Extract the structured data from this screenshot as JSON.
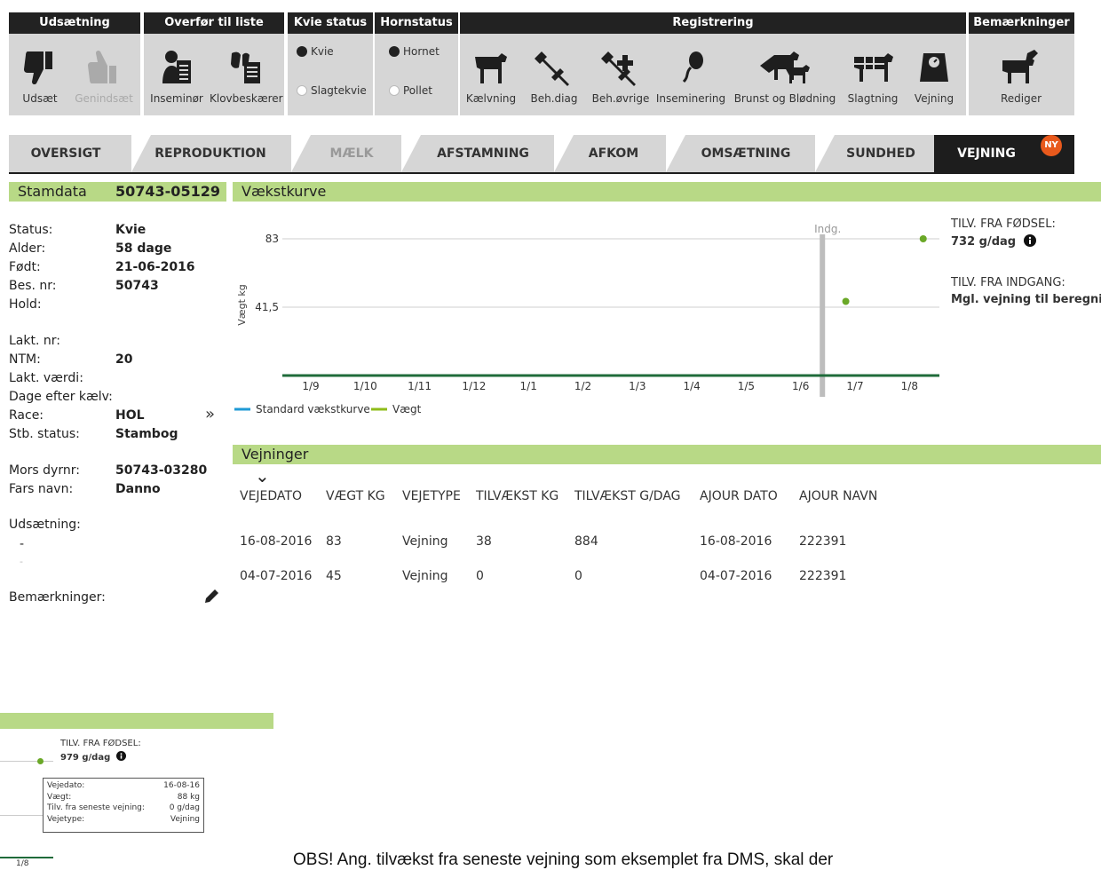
{
  "toolbar": {
    "udsaetning": {
      "header": "Udsætning",
      "udsaet": "Udsæt",
      "genindsaet": "Genindsæt"
    },
    "overfoer": {
      "header": "Overfør til liste",
      "inseminoer": "Inseminør",
      "klovbeskaerer": "Klovbeskærer"
    },
    "kvie_status": {
      "header": "Kvie status",
      "options": [
        "Kvie",
        "Slagtekvie"
      ],
      "selected": "Kvie"
    },
    "hornstatus": {
      "header": "Hornstatus",
      "options": [
        "Hornet",
        "Pollet"
      ],
      "selected": "Hornet"
    },
    "registrering": {
      "header": "Registrering",
      "items": [
        "Kælvning",
        "Beh.diag",
        "Beh.øvrige",
        "Inseminering",
        "Brunst og Blødning",
        "Slagtning",
        "Vejning"
      ]
    },
    "bemaerkninger": {
      "header": "Bemærkninger",
      "rediger": "Rediger"
    }
  },
  "tabs": [
    {
      "label": "OVERSIGT"
    },
    {
      "label": "REPRODUKTION"
    },
    {
      "label": "MÆLK"
    },
    {
      "label": "AFSTAMNING"
    },
    {
      "label": "AFKOM"
    },
    {
      "label": "OMSÆTNING"
    },
    {
      "label": "SUNDHED"
    },
    {
      "label": "VEJNING",
      "badge": "NY"
    }
  ],
  "stamdata": {
    "title": "Stamdata",
    "id": "50743-05129",
    "fields": {
      "status": {
        "label": "Status:",
        "value": "Kvie"
      },
      "alder": {
        "label": "Alder:",
        "value": "58 dage"
      },
      "foedt": {
        "label": "Født:",
        "value": "21-06-2016"
      },
      "bes_nr": {
        "label": "Bes. nr:",
        "value": "50743"
      },
      "hold": {
        "label": "Hold:",
        "value": ""
      },
      "lakt_nr": {
        "label": "Lakt. nr:",
        "value": ""
      },
      "ntm": {
        "label": "NTM:",
        "value": "20"
      },
      "lakt_vaerdi": {
        "label": "Lakt. værdi:",
        "value": ""
      },
      "dage_efter_kaelv": {
        "label": "Dage efter kælv:",
        "value": ""
      },
      "race": {
        "label": "Race:",
        "value": "HOL"
      },
      "stb_status": {
        "label": "Stb. status:",
        "value": "Stambog"
      },
      "mors_dyrnr": {
        "label": "Mors dyrnr:",
        "value": "50743-03280"
      },
      "fars_navn": {
        "label": "Fars navn:",
        "value": "Danno"
      }
    },
    "udsaetning_label": "Udsætning:",
    "udsaetning_value": "-",
    "udsaetning_value2": "-",
    "bemaerkninger_label": "Bemærkninger:",
    "expand_glyph": "»"
  },
  "vaekstkurve": {
    "title": "Vækstkurve",
    "tilv_foedsel_label": "TILV. FRA FØDSEL:",
    "tilv_foedsel_value": "732 g/dag",
    "tilv_indgang_label": "TILV. FRA INDGANG:",
    "tilv_indgang_value": "Mgl. vejning til beregnir"
  },
  "chart_data": {
    "type": "line",
    "ylabel": "Vægt kg",
    "yticks": [
      83,
      41.5
    ],
    "ytick_labels": [
      "83",
      "41,5"
    ],
    "ylim": [
      0,
      90
    ],
    "x_tick_labels": [
      "1/9",
      "1/10",
      "1/11",
      "1/12",
      "1/1",
      "1/2",
      "1/3",
      "1/4",
      "1/5",
      "1/6",
      "1/7",
      "1/8"
    ],
    "marker": {
      "label": "Indg.",
      "x": "2017-06-21"
    },
    "legend": [
      "Standard vækstkurve",
      "Vægt"
    ],
    "legend_colors": [
      "#1f9ad6",
      "#8fbc1a"
    ],
    "grid": true,
    "series": [
      {
        "name": "Vægt",
        "color": "#6aa827",
        "points": [
          {
            "x": "2017-07-04",
            "y": 45
          },
          {
            "x": "2017-08-16",
            "y": 83
          }
        ]
      }
    ]
  },
  "vejninger": {
    "title": "Vejninger",
    "sort_glyph": "⌄",
    "columns": [
      "VEJEDATO",
      "VÆGT KG",
      "VEJETYPE",
      "TILVÆKST KG",
      "TILVÆKST G/DAG",
      "AJOUR DATO",
      "AJOUR NAVN"
    ],
    "rows": [
      [
        "16-08-2016",
        "83",
        "Vejning",
        "38",
        "884",
        "16-08-2016",
        "222391"
      ],
      [
        "04-07-2016",
        "45",
        "Vejning",
        "0",
        "0",
        "04-07-2016",
        "222391"
      ]
    ]
  },
  "inset": {
    "tilv_label": "TILV. FRA FØDSEL:",
    "tilv_value": "979 g/dag",
    "tick": "1/8",
    "tooltip": [
      {
        "label": "Vejedato:",
        "value": "16-08-16"
      },
      {
        "label": "Vægt:",
        "value": "88 kg"
      },
      {
        "label": "Tilv. fra seneste vejning:",
        "value": "0 g/dag"
      },
      {
        "label": "Vejetype:",
        "value": "Vejning"
      }
    ]
  },
  "note_text": "OBS! Ang. tilvækst fra seneste vejning som eksemplet fra DMS, skal der"
}
